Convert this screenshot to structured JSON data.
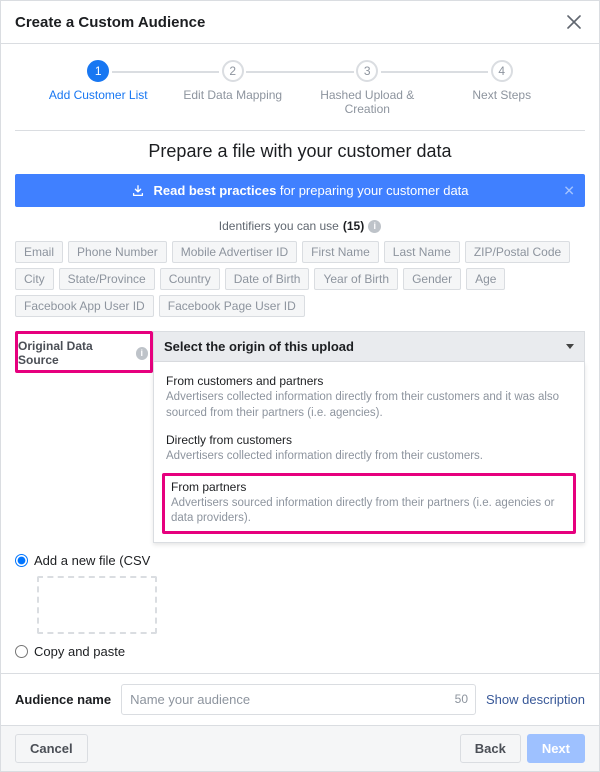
{
  "header": {
    "title": "Create a Custom Audience"
  },
  "steps": [
    {
      "num": "1",
      "label": "Add Customer List",
      "active": true
    },
    {
      "num": "2",
      "label": "Edit Data Mapping",
      "active": false
    },
    {
      "num": "3",
      "label": "Hashed Upload & Creation",
      "active": false
    },
    {
      "num": "4",
      "label": "Next Steps",
      "active": false
    }
  ],
  "main_heading": "Prepare a file with your customer data",
  "banner": {
    "icon": "import-icon",
    "bold": "Read best practices",
    "rest": " for preparing your customer data"
  },
  "identifiers": {
    "prefix": "Identifiers you can use",
    "count": "(15)",
    "items": [
      "Email",
      "Phone Number",
      "Mobile Advertiser ID",
      "First Name",
      "Last Name",
      "ZIP/Postal Code",
      "City",
      "State/Province",
      "Country",
      "Date of Birth",
      "Year of Birth",
      "Gender",
      "Age",
      "Facebook App User ID",
      "Facebook Page User ID"
    ]
  },
  "source": {
    "label": "Original Data Source",
    "placeholder": "Select the origin of this upload",
    "options": [
      {
        "title": "From customers and partners",
        "desc": "Advertisers collected information directly from their customers and it was also sourced from their partners (i.e. agencies)."
      },
      {
        "title": "Directly from customers",
        "desc": "Advertisers collected information directly from their customers."
      },
      {
        "title": "From partners",
        "desc": "Advertisers sourced information directly from their partners (i.e. agencies or data providers).",
        "highlight": true
      }
    ]
  },
  "radios": {
    "add_file": "Add a new file (CSV",
    "copy_paste": "Copy and paste"
  },
  "audience": {
    "label": "Audience name",
    "placeholder": "Name your audience",
    "char_remaining": "50",
    "show_desc": "Show description"
  },
  "actions": {
    "cancel": "Cancel",
    "back": "Back",
    "next": "Next"
  }
}
